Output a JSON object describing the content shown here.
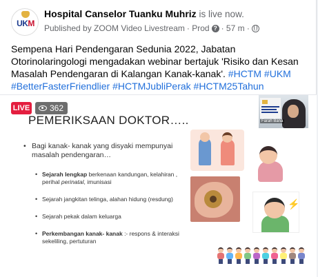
{
  "post": {
    "page_name": "Hospital Canselor Tuanku Muhriz",
    "status_text": "is live now.",
    "published_by": "Published by ZOOM Video Livestream",
    "audience_label": "· Prod",
    "time_ago": "· 57 m ·",
    "avatar": {
      "logo_text_u": "UK",
      "logo_text_m": "M",
      "icon": "ukm-logo-icon"
    },
    "caption_text": "Sempena Hari Pendengaran Sedunia 2022, Jabatan Otorinolaringologi mengadakan webinar bertajuk 'Risiko dan Kesan Masalah Pendengaran di Kalangan Kanak-kanak'.",
    "hashtags": [
      "#HCTM",
      "#UKM",
      "#BetterFasterFriendlier",
      "#HCTMJubliPerak",
      "#HCTM25Tahun"
    ]
  },
  "video": {
    "live_label": "LIVE",
    "viewer_count": "362",
    "slide": {
      "title": "PEMERIKSAAN DOKTOR…..",
      "main_bullet": "Bagi kanak- kanak yang disyaki mempunyai masalah pendengaran…",
      "items": [
        {
          "bold": "Sejarah lengkap",
          "text": " berkenaan kandungan, kelahiran , perihal ",
          "italic": "perinatal",
          "tail": ", imunisasi"
        },
        {
          "bold": "",
          "text": "Sejarah jangkitan telinga, alahan hidung (resdung)",
          "italic": "",
          "tail": ""
        },
        {
          "bold": "",
          "text": "Sejarah pekak dalam keluarga",
          "italic": "",
          "tail": ""
        },
        {
          "bold": "Perkembangan kanak- kanak",
          "text": " :- respons & interaksi sekeliling, pertuturan",
          "italic": "",
          "tail": ""
        }
      ]
    },
    "presenter": {
      "name": "Farah Bana"
    }
  },
  "colors": {
    "live_red": "#e41e3f",
    "hashtag_blue": "#216fdb",
    "secondary_text": "#65676b"
  }
}
